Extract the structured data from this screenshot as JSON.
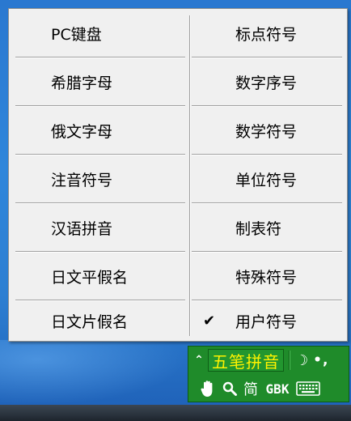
{
  "menu": {
    "left": [
      {
        "label": "PC键盘"
      },
      {
        "label": "希腊字母"
      },
      {
        "label": "俄文字母"
      },
      {
        "label": "注音符号"
      },
      {
        "label": "汉语拼音"
      },
      {
        "label": "日文平假名"
      },
      {
        "label": "日文片假名"
      }
    ],
    "right": [
      {
        "label": "标点符号"
      },
      {
        "label": "数字序号"
      },
      {
        "label": "数学符号"
      },
      {
        "label": "单位符号"
      },
      {
        "label": "制表符"
      },
      {
        "label": "特殊符号"
      },
      {
        "label": "用户符号",
        "checked": true
      }
    ],
    "check_glyph": "✔"
  },
  "ime": {
    "expand_glyph": "⌃",
    "mode_label": "五笔拼音",
    "moon_glyph": "☽",
    "punct_glyph": "•,",
    "simplified_label": "简",
    "encoding_label": "GBK",
    "accent_color": "#1f8b2a",
    "label_color": "#fff200"
  }
}
